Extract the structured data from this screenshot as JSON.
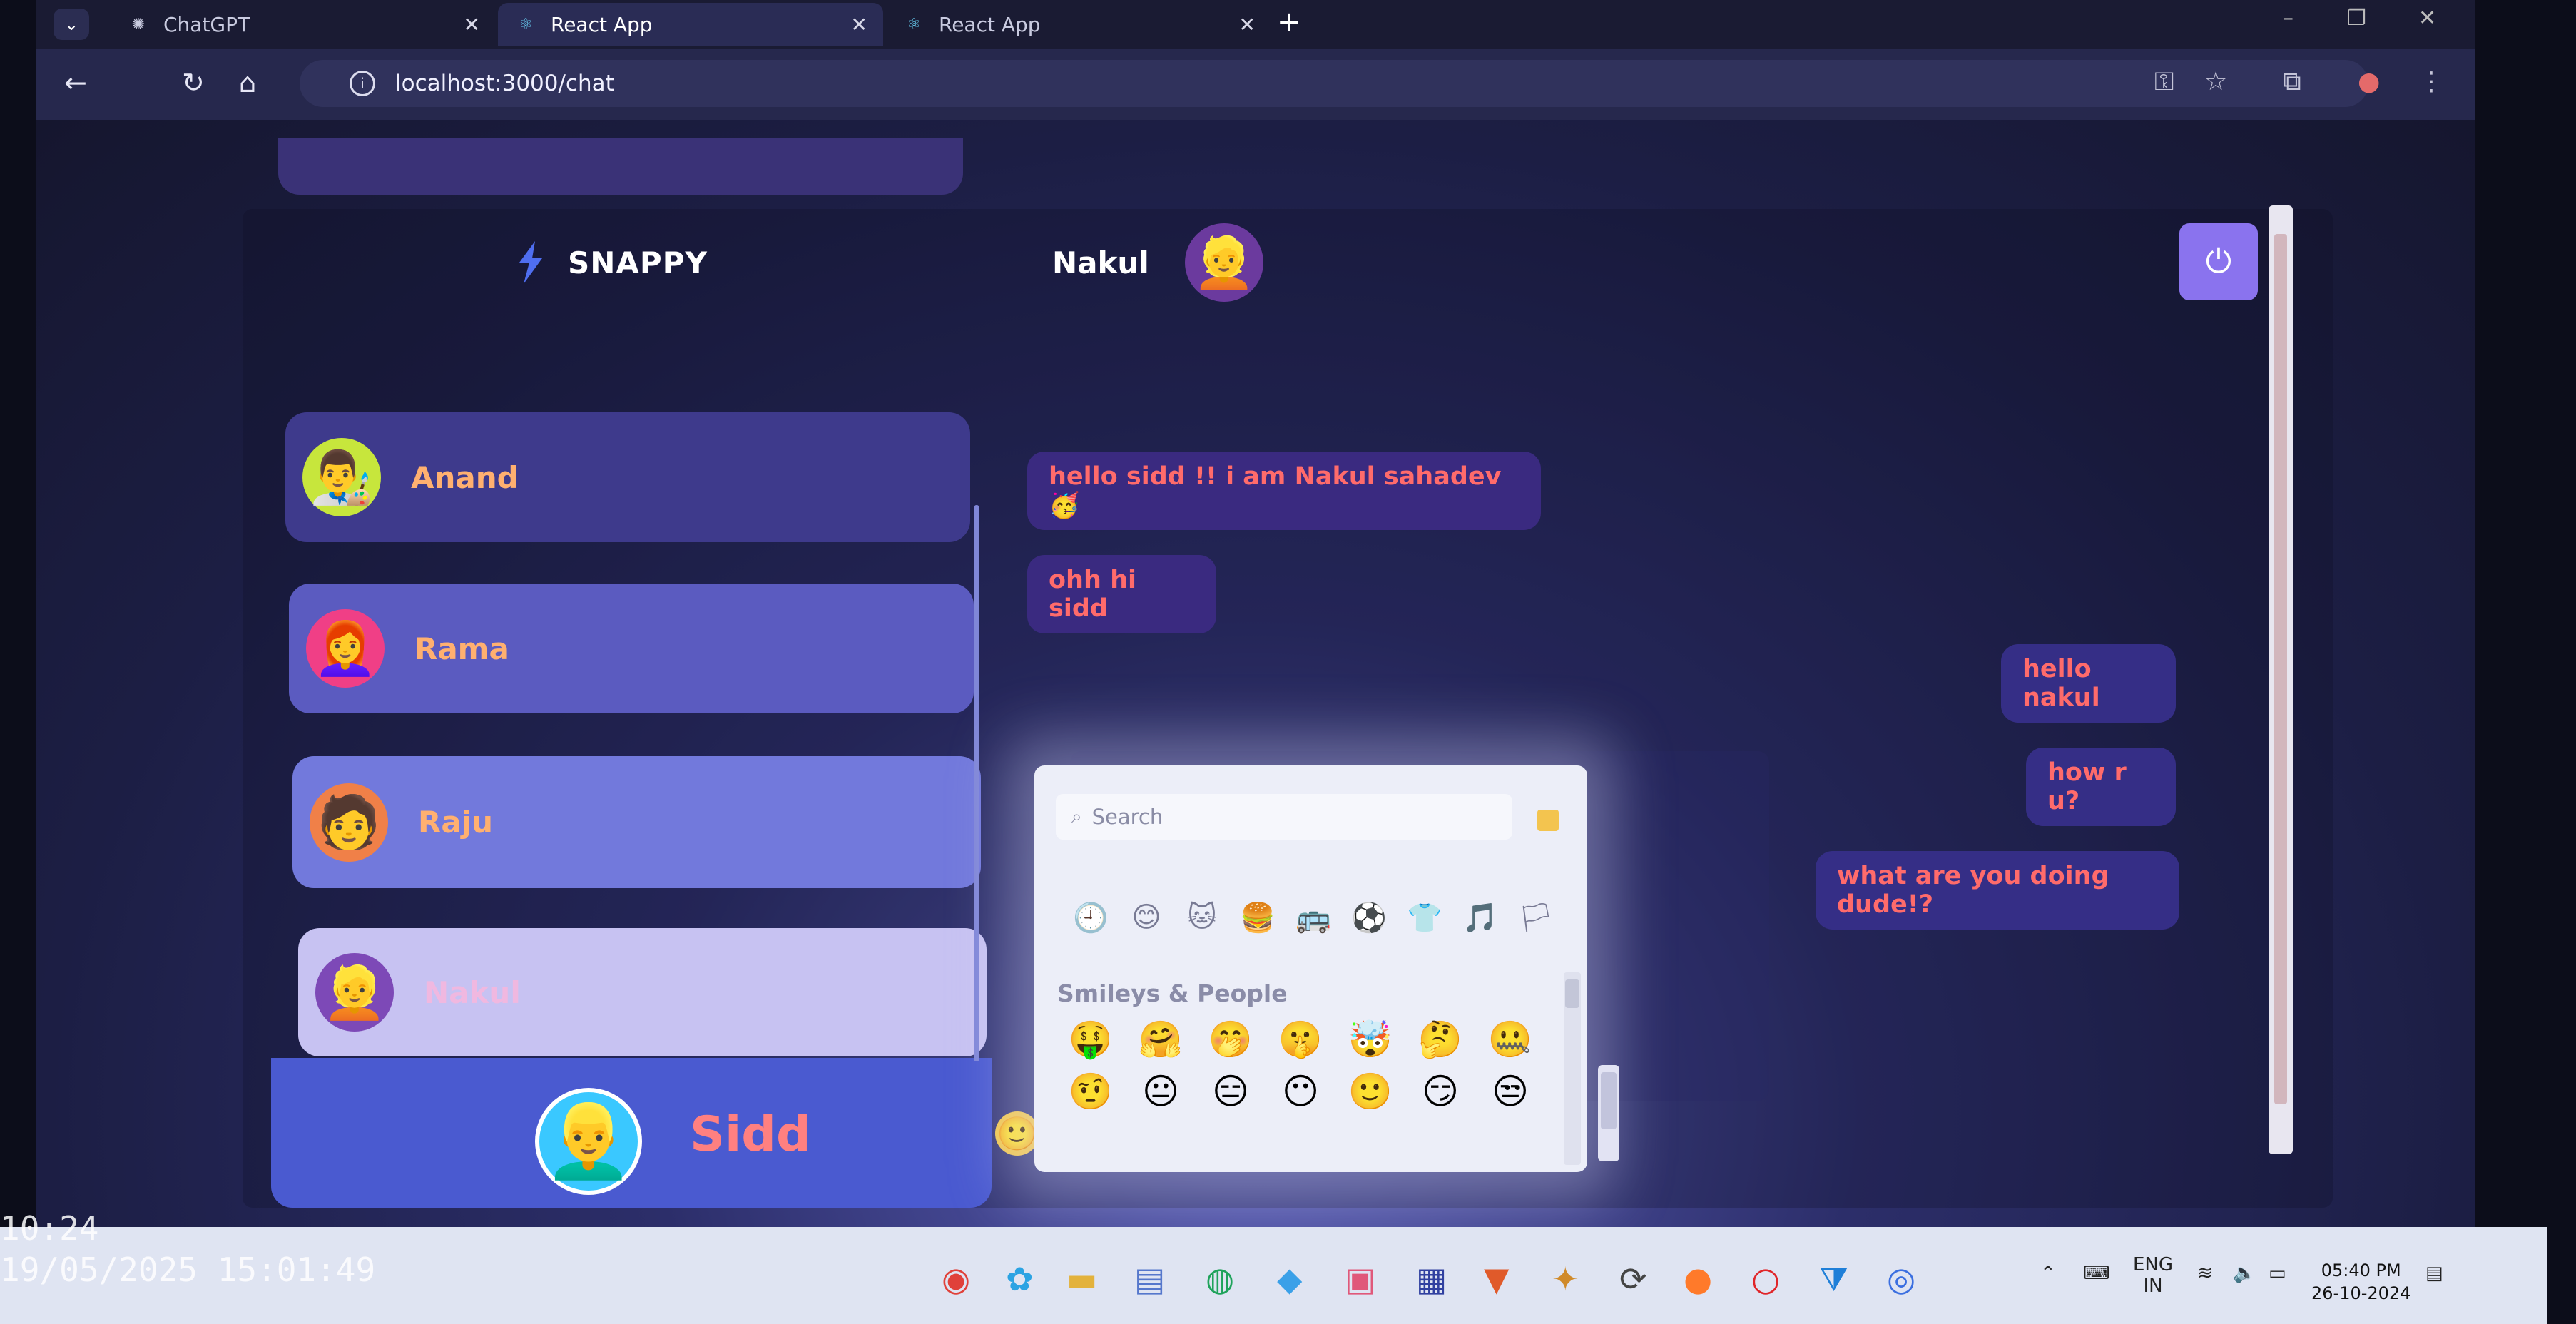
{
  "browser": {
    "tabs": [
      {
        "title": "ChatGPT",
        "icon": "openai-icon",
        "active": false
      },
      {
        "title": "React App",
        "icon": "react-icon",
        "active": true
      },
      {
        "title": "React App",
        "icon": "react-icon",
        "active": false
      }
    ],
    "url": "localhost:3000/chat"
  },
  "app": {
    "brand": "SNAPPY",
    "contacts": [
      {
        "name": "Anand",
        "avatar": "👨‍🎨"
      },
      {
        "name": "Rama",
        "avatar": "👩‍🦰"
      },
      {
        "name": "Raju",
        "avatar": "🧑"
      },
      {
        "name": "Nakul",
        "avatar": "👱",
        "selected": true
      }
    ],
    "current_user": {
      "name": "Sidd",
      "avatar": "👱‍♂️"
    },
    "chat": {
      "contact_name": "Nakul",
      "messages": [
        {
          "text": "hello sidd !! i am Nakul sahadev🥳",
          "type": "received"
        },
        {
          "text": "ohh hi sidd",
          "type": "received"
        },
        {
          "text": "hello nakul",
          "type": "sent"
        },
        {
          "text": "how r u?",
          "type": "sent"
        },
        {
          "text": "what are you doing dude!?",
          "type": "sent"
        }
      ]
    },
    "emoji_picker": {
      "search_placeholder": "Search",
      "category_label": "Smileys & People",
      "categories": [
        "🕘",
        "😊",
        "🐱",
        "🍔",
        "🚌",
        "⚽",
        "👕",
        "🎵",
        "🏳"
      ],
      "emojis": [
        "🤑",
        "🤗",
        "🤭",
        "🤫",
        "🤯",
        "🤔",
        "🤐",
        "🤨",
        "😐",
        "😑",
        "😶",
        "🙂",
        "😏",
        "😒"
      ]
    }
  },
  "taskbar": {
    "language": "ENG",
    "region": "IN",
    "time": "05:40 PM",
    "date": "26-10-2024"
  },
  "overlay": {
    "time": "10:24",
    "date": "19/05/2025 15:01:49"
  }
}
